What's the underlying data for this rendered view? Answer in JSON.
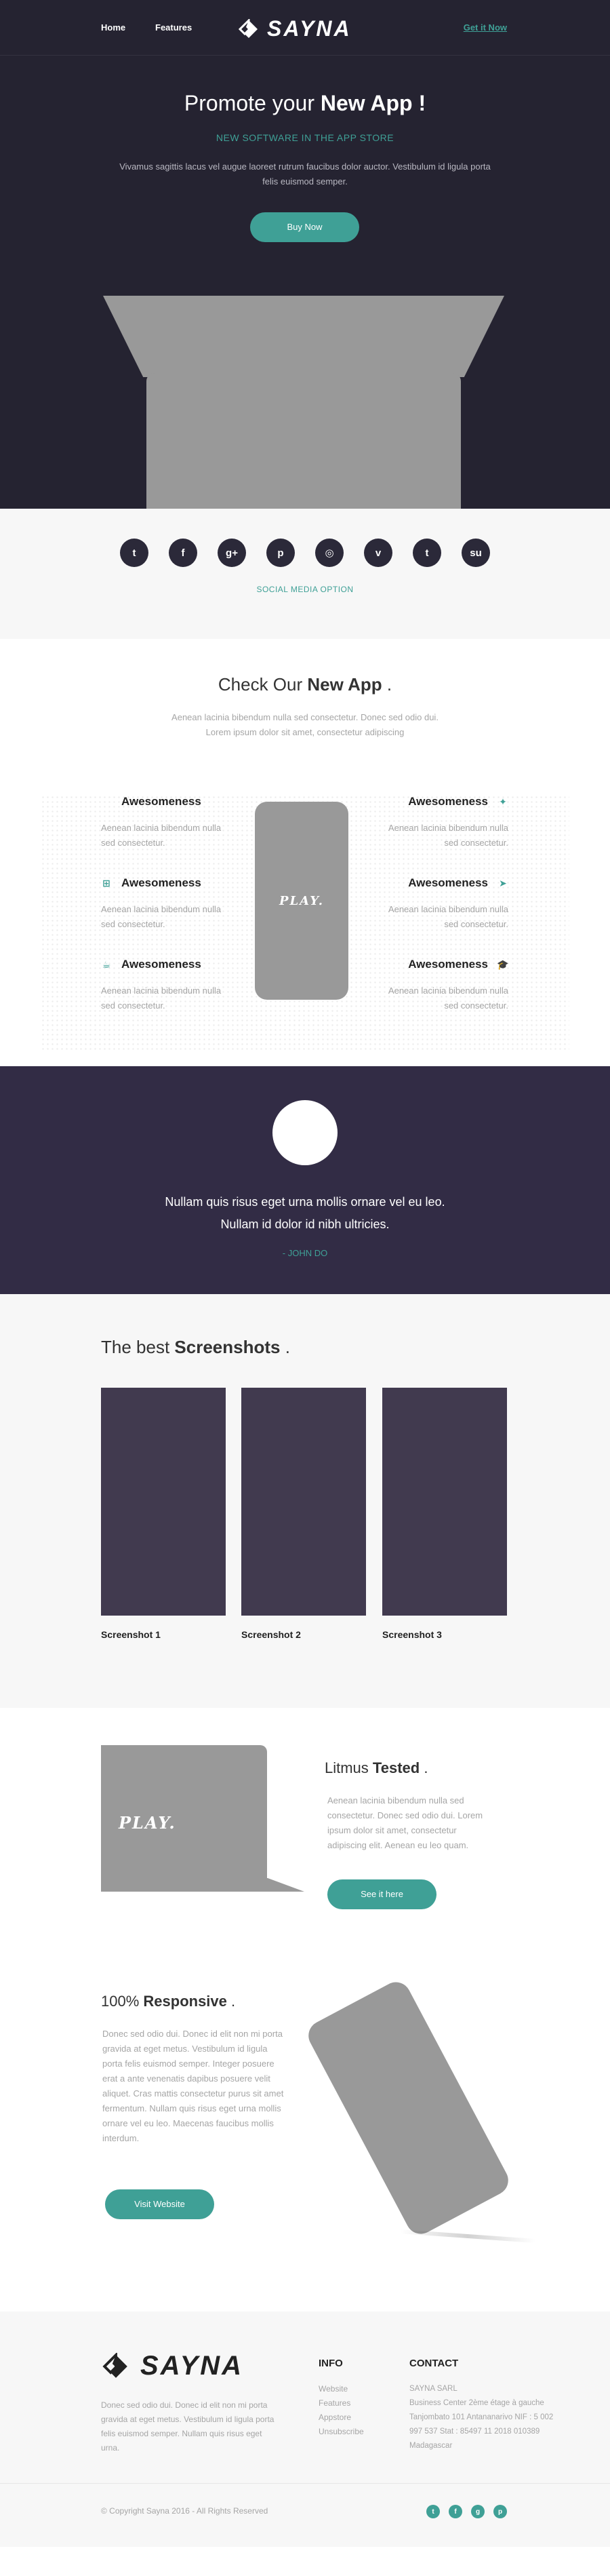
{
  "nav": {
    "home": "Home",
    "features": "Features",
    "get_it": "Get it Now",
    "logo": "SAYNA"
  },
  "hero": {
    "title_pre": "Promote your ",
    "title_bold": "New App !",
    "subtitle": "NEW SOFTWARE IN THE APP STORE",
    "desc": "Vivamus sagittis lacus vel augue laoreet rutrum faucibus dolor auctor. Vestibulum id ligula porta felis euismod semper.",
    "button": "Buy Now"
  },
  "social": {
    "icons": [
      "twitter-icon",
      "facebook-icon",
      "google-plus-icon",
      "pinterest-icon",
      "dribbble-icon",
      "vimeo-icon",
      "tumblr-icon",
      "stumbleupon-icon"
    ],
    "glyphs": [
      "t",
      "f",
      "g+",
      "p",
      "◎",
      "v",
      "t",
      "su"
    ],
    "label": "SOCIAL MEDIA OPTION"
  },
  "check": {
    "title_pre": "Check Our ",
    "title_bold": "New App",
    "title_post": " .",
    "intro": "Aenean lacinia bibendum nulla sed consectetur. Donec sed odio dui. Lorem ipsum dolor sit amet, consectetur adipiscing",
    "phone_text": "PLAY.",
    "features_left": [
      {
        "title": "Awesomeness",
        "text": "Aenean lacinia bibendum nulla sed consectetur.",
        "icon": "apple-icon",
        "glyph": ""
      },
      {
        "title": "Awesomeness",
        "text": "Aenean lacinia bibendum nulla sed consectetur.",
        "icon": "windows-icon",
        "glyph": "⊞"
      },
      {
        "title": "Awesomeness",
        "text": "Aenean lacinia bibendum nulla sed consectetur.",
        "icon": "coffee-icon",
        "glyph": "☕"
      }
    ],
    "features_right": [
      {
        "title": "Awesomeness",
        "text": "Aenean lacinia bibendum nulla sed consectetur.",
        "icon": "android-icon",
        "glyph": "✦"
      },
      {
        "title": "Awesomeness",
        "text": "Aenean lacinia bibendum nulla sed consectetur.",
        "icon": "send-icon",
        "glyph": "➤"
      },
      {
        "title": "Awesomeness",
        "text": "Aenean lacinia bibendum nulla sed consectetur.",
        "icon": "graduation-cap-icon",
        "glyph": "🎓"
      }
    ]
  },
  "testimonial": {
    "quote_line1": "Nullam quis risus eget urna mollis ornare vel eu leo.",
    "quote_line2": "Nullam id dolor id nibh ultricies.",
    "author": "- JOHN DO"
  },
  "screenshots": {
    "title_pre": "The best ",
    "title_bold": "Screenshots",
    "title_post": " .",
    "items": [
      "Screenshot 1",
      "Screenshot 2",
      "Screenshot 3"
    ]
  },
  "litmus": {
    "title_pre": "Litmus ",
    "title_bold": "Tested",
    "title_post": " .",
    "text": "Aenean lacinia bibendum nulla sed consectetur. Donec sed odio dui. Lorem ipsum dolor sit amet, consectetur adipiscing elit. Aenean eu leo quam.",
    "button": "See it here",
    "laptop_text": "PLAY."
  },
  "responsive": {
    "title_pre": "100% ",
    "title_bold": "Responsive",
    "title_post": " .",
    "text": "Donec sed odio dui. Donec id elit non mi porta gravida at eget metus. Vestibulum id ligula porta felis euismod semper. Integer posuere erat a ante venenatis dapibus posuere velit aliquet. Cras mattis consectetur purus sit amet fermentum. Nullam quis risus eget urna mollis ornare vel eu leo. Maecenas faucibus mollis interdum.",
    "button": "Visit Website"
  },
  "footer": {
    "logo": "SAYNA",
    "about": "Donec sed odio dui. Donec id elit non mi porta gravida at eget metus. Vestibulum id ligula porta felis euismod semper. Nullam quis risus eget urna.",
    "info_title": "INFO",
    "info_links": [
      "Website",
      "Features",
      "Appstore",
      "Unsubscribe"
    ],
    "contact_title": "CONTACT",
    "contact_lines": [
      "SAYNA SARL",
      "Business Center 2ème étage à gauche",
      "Tanjombato 101 Antananarivo NIF : 5 002",
      "997 537 Stat : 85497 11 2018 010389",
      "Madagascar"
    ],
    "copyright": "© Copyright Sayna 2016 - All Rights Reserved",
    "social_icons": [
      "twitter-icon",
      "facebook-icon",
      "google-plus-icon",
      "pinterest-icon"
    ],
    "social_glyphs": [
      "t",
      "f",
      "g",
      "p"
    ]
  },
  "colors": {
    "accent": "#3fa096",
    "dark": "#252331",
    "purple": "#322c45",
    "light": "#f7f7f7"
  }
}
